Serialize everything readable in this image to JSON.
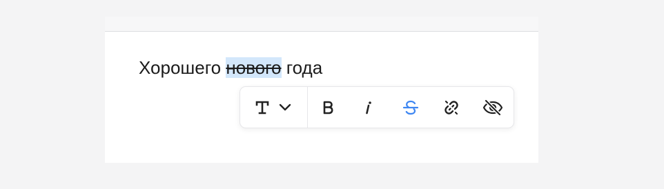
{
  "editor": {
    "text_before": "Хорошего ",
    "text_selected": "нового",
    "text_after": " года"
  },
  "toolbar": {
    "buttons": [
      {
        "name": "text-type",
        "icon": "text-type-icon",
        "label": "T"
      },
      {
        "name": "bold",
        "icon": "bold-icon",
        "label": "B"
      },
      {
        "name": "italic",
        "icon": "italic-icon",
        "label": "i"
      },
      {
        "name": "strikethrough",
        "icon": "strikethrough-icon",
        "active": true
      },
      {
        "name": "link",
        "icon": "link-icon"
      },
      {
        "name": "hide",
        "icon": "eye-off-icon"
      }
    ],
    "active_color": "#3d86f2",
    "icon_color": "#222222"
  },
  "colors": {
    "selection": "#d3e7fb",
    "background": "#f4f4f5"
  }
}
